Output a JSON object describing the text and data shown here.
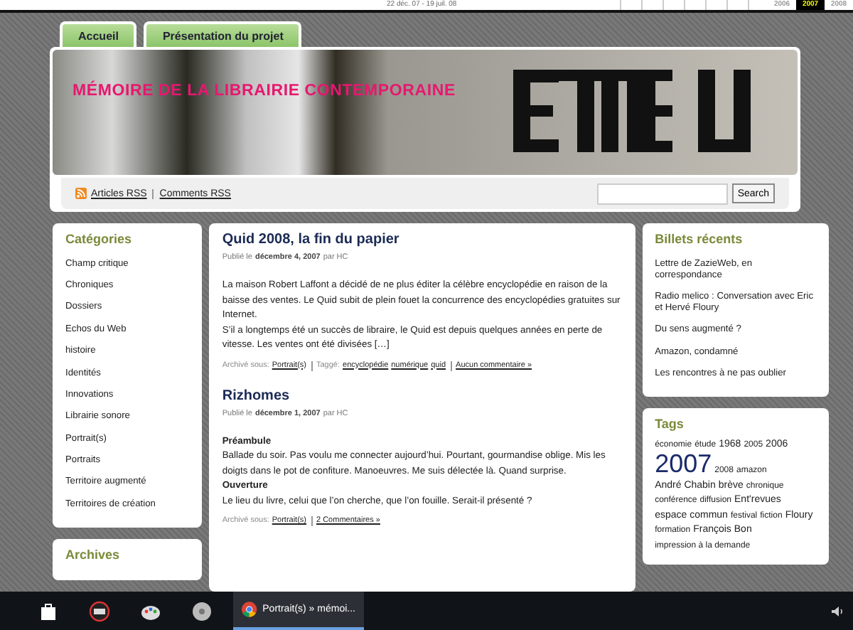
{
  "timeline": {
    "range": "22 déc. 07 - 19 juil. 08",
    "years": [
      {
        "label": "2006",
        "selected": false
      },
      {
        "label": "2007",
        "selected": true
      },
      {
        "label": "2008",
        "selected": false
      }
    ]
  },
  "tabs": [
    {
      "label": "Accueil"
    },
    {
      "label": "Présentation du projet"
    }
  ],
  "header": {
    "title": "MÉMOIRE DE LA LIBRAIRIE CONTEMPORAINE",
    "feeds": [
      "Articles RSS",
      "Comments RSS"
    ],
    "search_button": "Search"
  },
  "categories": {
    "title": "Catégories",
    "items": [
      "Champ critique",
      "Chroniques",
      "Dossiers",
      "Echos du Web",
      "histoire",
      "Identités",
      "Innovations",
      "Librairie sonore",
      "Portrait(s)",
      "Portraits",
      "Territoire augmenté",
      "Territoires de création"
    ]
  },
  "archives": {
    "title": "Archives"
  },
  "posts": [
    {
      "title": "Quid 2008, la fin du papier",
      "meta_prefix": "Publié le",
      "date": "décembre 4, 2007",
      "meta_by": "par HC",
      "paragraphs": [
        {
          "kind": "text",
          "text": "La maison Robert Laffont a décidé de ne plus éditer la célèbre encyclopédie en raison de la baisse des ventes. Le Quid subit de plein fouet la concurrence des encyclopédies gratuites sur Internet."
        },
        {
          "kind": "text",
          "text": "S’il a longtemps été un succès de libraire, le Quid est depuis quelques années en perte de vitesse. Les ventes ont été divisées […]"
        }
      ],
      "footer": {
        "archived": "Archivé sous:",
        "category": "Portrait(s)",
        "tagged": "Taggé:",
        "tags": [
          "encyclopédie",
          "numérique",
          "quid"
        ],
        "comments": "Aucun commentaire »"
      }
    },
    {
      "title": "Rizhomes",
      "meta_prefix": "Publié le",
      "date": "décembre 1, 2007",
      "meta_by": "par HC",
      "paragraphs": [
        {
          "kind": "heading",
          "text": "Préambule"
        },
        {
          "kind": "text",
          "text": "Ballade du soir. Pas voulu me connecter aujourd’hui. Pourtant, gourmandise oblige. Mis les doigts dans le pot de confiture. Manoeuvres. Me suis délectée là. Quand surprise."
        },
        {
          "kind": "heading",
          "text": "Ouverture"
        },
        {
          "kind": "text",
          "text": "Le lieu du livre, celui que l’on cherche, que l’on fouille. Serait-il présenté ?"
        }
      ],
      "footer": {
        "archived": "Archivé sous:",
        "category": "Portrait(s)",
        "comments": "2 Commentaires »"
      }
    }
  ],
  "recent": {
    "title": "Billets récents",
    "items": [
      "Lettre de ZazieWeb, en correspondance",
      "Radio melico : Conversation avec Eric et Hervé Floury",
      "Du sens augmenté ?",
      "Amazon, condamné",
      "Les rencontres à ne pas oublier"
    ]
  },
  "tags": {
    "title": "Tags",
    "items": [
      {
        "label": "économie",
        "kind": "small"
      },
      {
        "label": "étude",
        "kind": "small"
      },
      {
        "label": "1968",
        "kind": "medium"
      },
      {
        "label": "2005",
        "kind": "small"
      },
      {
        "label": "2006",
        "kind": "medium"
      },
      {
        "label": "2007",
        "kind": "huge"
      },
      {
        "label": "2008",
        "kind": "small"
      },
      {
        "label": "amazon",
        "kind": "small"
      },
      {
        "label": "André Chabin",
        "kind": "medium"
      },
      {
        "label": "brève",
        "kind": "medium"
      },
      {
        "label": "chronique",
        "kind": "small"
      },
      {
        "label": "conférence",
        "kind": "small"
      },
      {
        "label": "diffusion",
        "kind": "small"
      },
      {
        "label": "Ent'revues",
        "kind": "medium"
      },
      {
        "label": "espace commun",
        "kind": "medium"
      },
      {
        "label": "festival",
        "kind": "small"
      },
      {
        "label": "fiction",
        "kind": "small"
      },
      {
        "label": "Floury",
        "kind": "medium"
      },
      {
        "label": "formation",
        "kind": "small"
      },
      {
        "label": "François Bon",
        "kind": "medium"
      },
      {
        "label": "impression à la demande",
        "kind": "small"
      }
    ]
  },
  "taskbar": {
    "active_window": "Portrait(s) » mémoi..."
  }
}
